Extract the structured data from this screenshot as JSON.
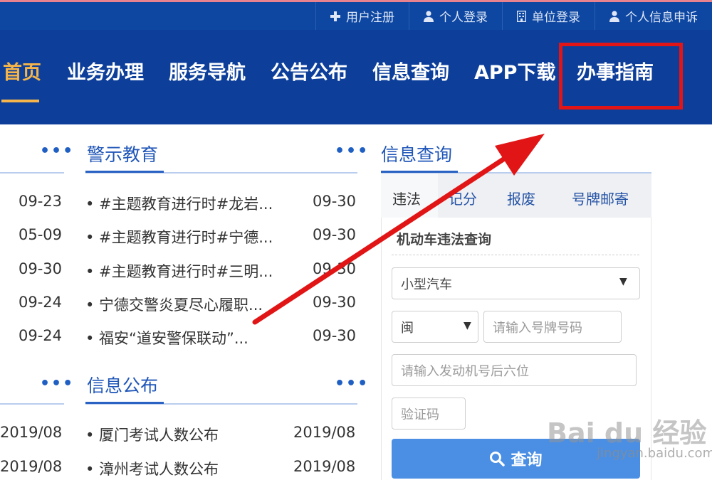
{
  "top_links": [
    {
      "icon": "plus-icon",
      "label": "用户注册"
    },
    {
      "icon": "person-icon",
      "label": "个人登录"
    },
    {
      "icon": "building-icon",
      "label": "单位登录"
    },
    {
      "icon": "person-icon",
      "label": "个人信息申诉"
    }
  ],
  "nav": [
    {
      "label": "首页",
      "active": true
    },
    {
      "label": "业务办理"
    },
    {
      "label": "服务导航"
    },
    {
      "label": "公告公布"
    },
    {
      "label": "信息查询"
    },
    {
      "label": "APP下载"
    },
    {
      "label": "办事指南"
    }
  ],
  "more_label": "•••",
  "left_col": {
    "dates_top": [
      "09-23",
      "05-09",
      "09-30",
      "09-24",
      "09-24"
    ],
    "dates_bottom": [
      "2019/08",
      "2019/08"
    ]
  },
  "warning_edu": {
    "title": "警示教育",
    "items": [
      {
        "text": "• #主题教育进行时#龙岩...",
        "date": "09-30"
      },
      {
        "text": "• #主题教育进行时#宁德...",
        "date": "09-30"
      },
      {
        "text": "• #主题教育进行时#三明...",
        "date": "09-30"
      },
      {
        "text": "• 宁德交警炎夏尽心履职...",
        "date": "09-30"
      },
      {
        "text": "• 福安“道安警保联动”...",
        "date": "09-30"
      }
    ]
  },
  "info_publish": {
    "title": "信息公布",
    "items": [
      {
        "text": "• 厦门考试人数公布",
        "date": "2019/08"
      },
      {
        "text": "• 漳州考试人数公布",
        "date": "2019/08"
      }
    ]
  },
  "info_query": {
    "title": "信息查询",
    "tabs": [
      "违法",
      "记分",
      "报废",
      "号牌邮寄"
    ],
    "form_title": "机动车违法查询",
    "vehicle_type": "小型汽车",
    "province": "闽",
    "plate_placeholder": "请输入号牌号码",
    "engine_placeholder": "请输入发动机号后六位",
    "captcha_placeholder": "验证码",
    "query_label": "查询"
  },
  "watermark": {
    "logo": "Bai du 经验",
    "url": "jingyan.baidu.com"
  },
  "colors": {
    "nav_bg": "#0d3f9a",
    "active": "#f5b54a",
    "highlight": "#e11515",
    "button": "#4a8fe4"
  }
}
